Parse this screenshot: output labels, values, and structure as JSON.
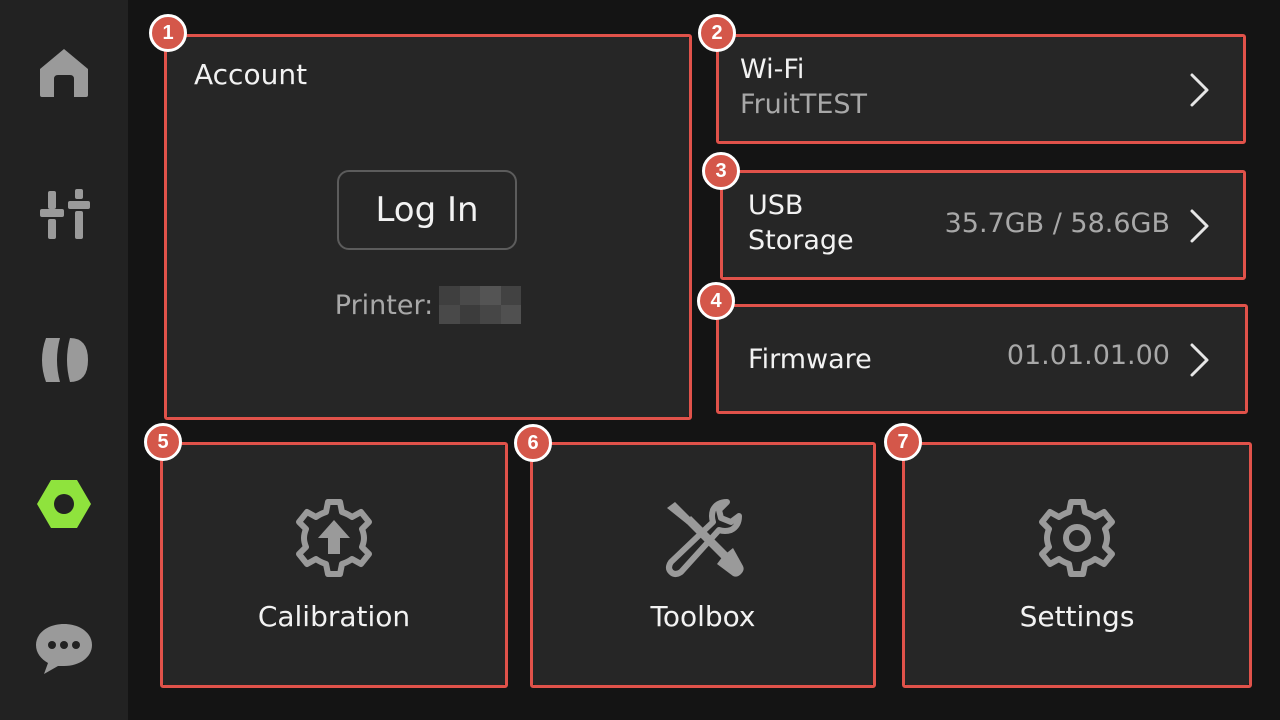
{
  "sidebar": {
    "items": [
      {
        "icon": "home-icon",
        "active": false
      },
      {
        "icon": "sliders-icon",
        "active": false
      },
      {
        "icon": "filament-icon",
        "active": false
      },
      {
        "icon": "hex-nut-settings-icon",
        "active": true
      },
      {
        "icon": "chat-bubble-icon",
        "active": false
      }
    ],
    "active_color": "#8fe33d",
    "inactive_color": "#9a9a9a"
  },
  "account": {
    "title": "Account",
    "login_label": "Log In",
    "printer_label": "Printer:"
  },
  "wifi": {
    "title": "Wi-Fi",
    "network": "FruitTEST"
  },
  "usb": {
    "title_line1": "USB",
    "title_line2": "Storage",
    "value": "35.7GB / 58.6GB"
  },
  "firmware": {
    "title": "Firmware",
    "version": "01.01.01.00"
  },
  "tiles": {
    "calibration": "Calibration",
    "toolbox": "Toolbox",
    "settings": "Settings"
  },
  "badges": [
    "1",
    "2",
    "3",
    "4",
    "5",
    "6",
    "7"
  ],
  "colors": {
    "highlight": "#e0524a",
    "badge": "#d4574a",
    "card": "#262626",
    "background": "#141414"
  }
}
